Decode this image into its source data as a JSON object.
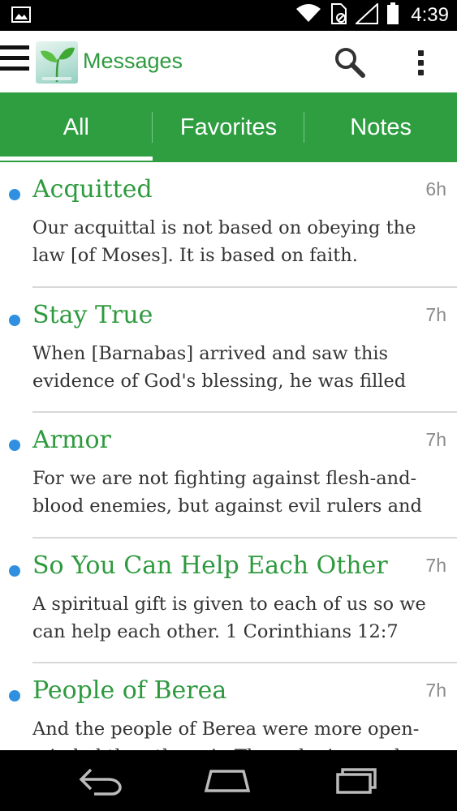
{
  "status_bar": {
    "time": "4:39",
    "icons": [
      "image-icon",
      "wifi-icon",
      "sim-card-icon",
      "signal-icon",
      "battery-icon"
    ]
  },
  "app_bar": {
    "title": "Messages",
    "logo": "sprout-logo",
    "actions": [
      "menu-icon",
      "search-icon",
      "overflow-menu-icon"
    ]
  },
  "tabs": [
    {
      "label": "All",
      "active": true
    },
    {
      "label": "Favorites",
      "active": false
    },
    {
      "label": "Notes",
      "active": false
    }
  ],
  "messages": [
    {
      "title": "Acquitted",
      "time": "6h",
      "body": "Our acquittal is not based on obeying the law [of Moses]. It is based on faith."
    },
    {
      "title": "Stay True",
      "time": "7h",
      "body": "When [Barnabas] arrived and saw this evidence of God's blessing, he was filled"
    },
    {
      "title": "Armor",
      "time": "7h",
      "body": "For we are not fighting against flesh-and-blood enemies, but against evil rulers and"
    },
    {
      "title": "So You Can Help Each Other",
      "time": "7h",
      "body": "A spiritual gift is given to each of us so we can help each other. 1 Corinthians 12:7"
    },
    {
      "title": "People of Berea",
      "time": "7h",
      "body": "And the people of Berea were more open-minded than those in Thessalonica, and"
    }
  ],
  "nav_bar": {
    "buttons": [
      "back-icon",
      "home-icon",
      "recent-apps-icon"
    ]
  },
  "colors": {
    "brand_green": "#2e9e41",
    "title_green": "#2e9a3e",
    "unread_dot": "#2f8fe0"
  }
}
